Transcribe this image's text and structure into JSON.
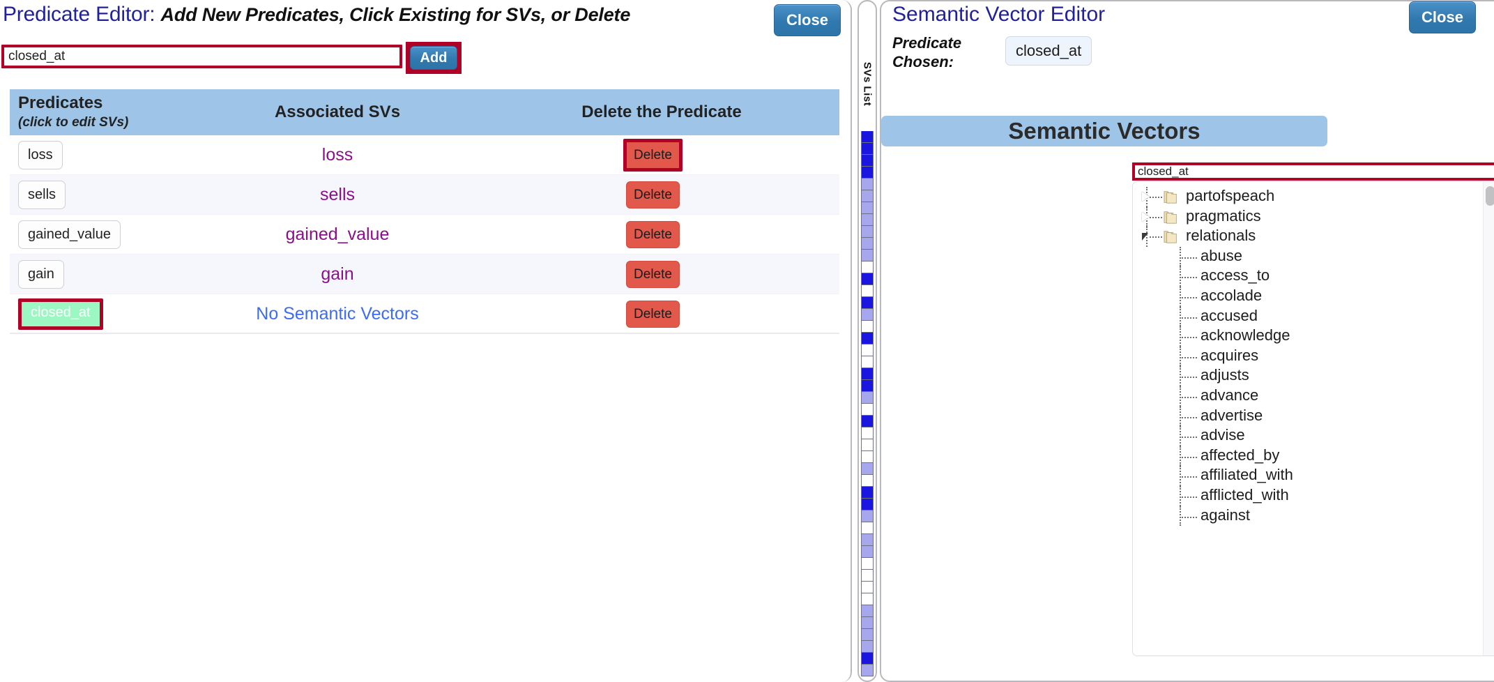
{
  "predicate_editor": {
    "title_lead": "Predicate Editor:",
    "title_sub": "Add New Predicates, Click Existing for SVs, or Delete",
    "close_label": "Close",
    "add_input_value": "closed_at",
    "add_input_placeholder": "",
    "add_label": "Add",
    "columns": {
      "predicates": "Predicates",
      "predicates_hint": "(click to edit SVs)",
      "associated_svs": "Associated SVs",
      "delete": "Delete the Predicate"
    },
    "delete_label": "Delete",
    "no_svs_label": "No Semantic Vectors",
    "rows": [
      {
        "predicate": "loss",
        "svs": "loss",
        "selected": false,
        "delete_focused": true
      },
      {
        "predicate": "sells",
        "svs": "sells",
        "selected": false,
        "delete_focused": false
      },
      {
        "predicate": "gained_value",
        "svs": "gained_value",
        "selected": false,
        "delete_focused": false
      },
      {
        "predicate": "gain",
        "svs": "gain",
        "selected": false,
        "delete_focused": false
      },
      {
        "predicate": "closed_at",
        "svs": "No Semantic Vectors",
        "selected": true,
        "delete_focused": false,
        "no_svs": true
      }
    ]
  },
  "sv_strip": {
    "label": "SVs List",
    "colors": [
      "#1a16e0",
      "#1a16e0",
      "#1a16e0",
      "#1a16e0",
      "#a7a7ee",
      "#a7a7ee",
      "#a7a7ee",
      "#a7a7ee",
      "#a7a7ee",
      "#a7a7ee",
      "#a7a7ee",
      "#ffffff",
      "#1a16e0",
      "#ffffff",
      "#1a16e0",
      "#a7a7ee",
      "#ffffff",
      "#1a16e0",
      "#ffffff",
      "#ffffff",
      "#1a16e0",
      "#1a16e0",
      "#a7a7ee",
      "#ffffff",
      "#1a16e0",
      "#ffffff",
      "#ffffff",
      "#ffffff",
      "#a7a7ee",
      "#ffffff",
      "#1a16e0",
      "#1a16e0",
      "#a7a7ee",
      "#ffffff",
      "#a7a7ee",
      "#a7a7ee",
      "#ffffff",
      "#ffffff",
      "#ffffff",
      "#ffffff",
      "#a7a7ee",
      "#a7a7ee",
      "#a7a7ee",
      "#a7a7ee",
      "#1a16e0",
      "#a7a7ee"
    ]
  },
  "sv_editor": {
    "title": "Semantic Vector Editor",
    "close_label": "Close",
    "predicate_chosen_label": "Predicate Chosen:",
    "predicate_chosen_value": "closed_at",
    "banner": "Semantic Vectors",
    "search_value": "closed_at",
    "search_placeholder": "",
    "tree": [
      {
        "label": "partofspeach",
        "type": "folder",
        "expanded": false
      },
      {
        "label": "pragmatics",
        "type": "folder",
        "expanded": false
      },
      {
        "label": "relationals",
        "type": "folder",
        "expanded": true
      },
      {
        "label": "abuse",
        "type": "leaf"
      },
      {
        "label": "access_to",
        "type": "leaf"
      },
      {
        "label": "accolade",
        "type": "leaf"
      },
      {
        "label": "accused",
        "type": "leaf"
      },
      {
        "label": "acknowledge",
        "type": "leaf"
      },
      {
        "label": "acquires",
        "type": "leaf"
      },
      {
        "label": "adjusts",
        "type": "leaf"
      },
      {
        "label": "advance",
        "type": "leaf"
      },
      {
        "label": "advertise",
        "type": "leaf"
      },
      {
        "label": "advise",
        "type": "leaf"
      },
      {
        "label": "affected_by",
        "type": "leaf"
      },
      {
        "label": "affiliated_with",
        "type": "leaf"
      },
      {
        "label": "afflicted_with",
        "type": "leaf"
      },
      {
        "label": "against",
        "type": "leaf"
      }
    ]
  },
  "colors": {
    "title_blue": "#21219c",
    "header_blue": "#9ec5e8",
    "accent_button_blue": "#3079ae",
    "highlight_red": "#b00126",
    "delete_red": "#e2584a",
    "selected_green": "#9df7c2",
    "sv_magenta": "#8a0f8a",
    "no_sv_blue": "#3d6cf0"
  }
}
